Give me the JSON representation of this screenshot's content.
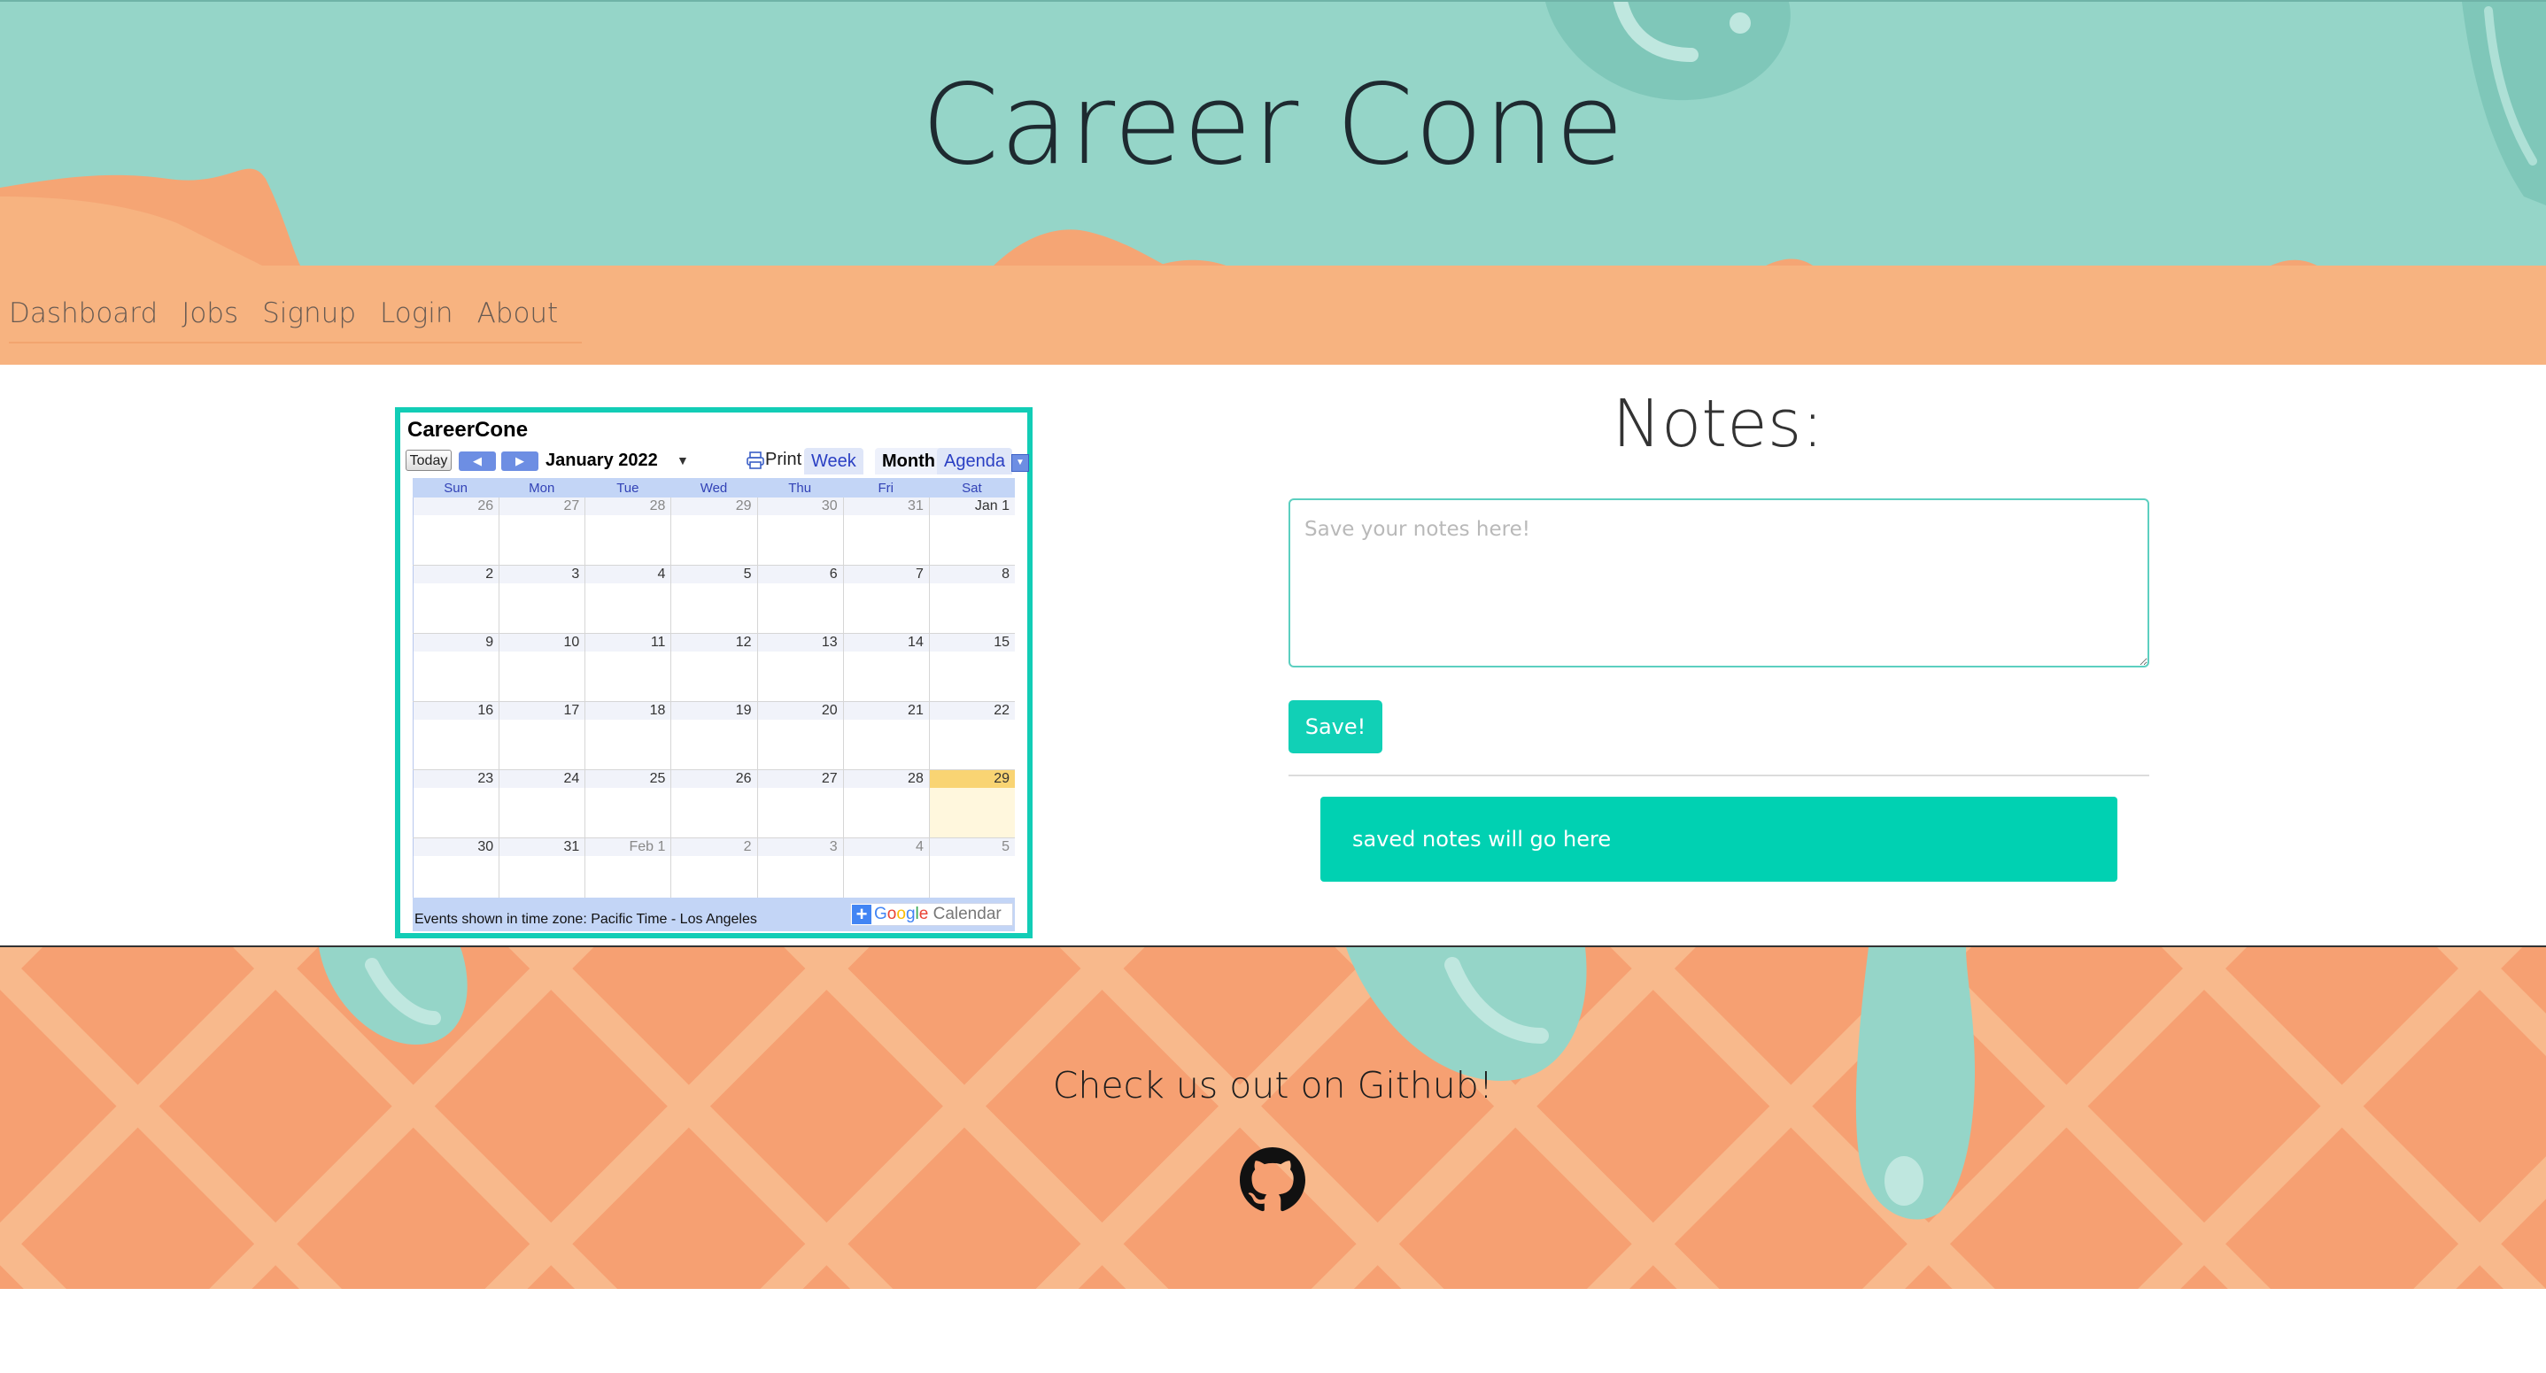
{
  "site": {
    "title": "Career Cone"
  },
  "nav": {
    "items": [
      "Dashboard",
      "Jobs",
      "Signup",
      "Login",
      "About"
    ]
  },
  "calendar": {
    "name": "CareerCone",
    "today_label": "Today",
    "month_label": "January 2022",
    "print_label": "Print",
    "views": [
      "Week",
      "Month",
      "Agenda"
    ],
    "active_view": "Month",
    "weekdays": [
      "Sun",
      "Mon",
      "Tue",
      "Wed",
      "Thu",
      "Fri",
      "Sat"
    ],
    "weeks": [
      [
        "26",
        "27",
        "28",
        "29",
        "30",
        "31",
        "Jan 1"
      ],
      [
        "2",
        "3",
        "4",
        "5",
        "6",
        "7",
        "8"
      ],
      [
        "9",
        "10",
        "11",
        "12",
        "13",
        "14",
        "15"
      ],
      [
        "16",
        "17",
        "18",
        "19",
        "20",
        "21",
        "22"
      ],
      [
        "23",
        "24",
        "25",
        "26",
        "27",
        "28",
        "29"
      ],
      [
        "30",
        "31",
        "Feb 1",
        "2",
        "3",
        "4",
        "5"
      ]
    ],
    "today": "29",
    "timezone_text": "Events shown in time zone: Pacific Time - Los Angeles",
    "google_calendar_label": "Google Calendar"
  },
  "notes": {
    "title": "Notes:",
    "placeholder": "Save your notes here!",
    "save_label": "Save!",
    "saved_text": "saved notes will go here"
  },
  "footer": {
    "text": "Check us out on Github!",
    "icon": "github-icon"
  },
  "colors": {
    "header_mint": "#95d5c8",
    "nav_peach": "#f7b380",
    "accent_teal": "#00d1b2",
    "footer_peach": "#f4a575"
  }
}
